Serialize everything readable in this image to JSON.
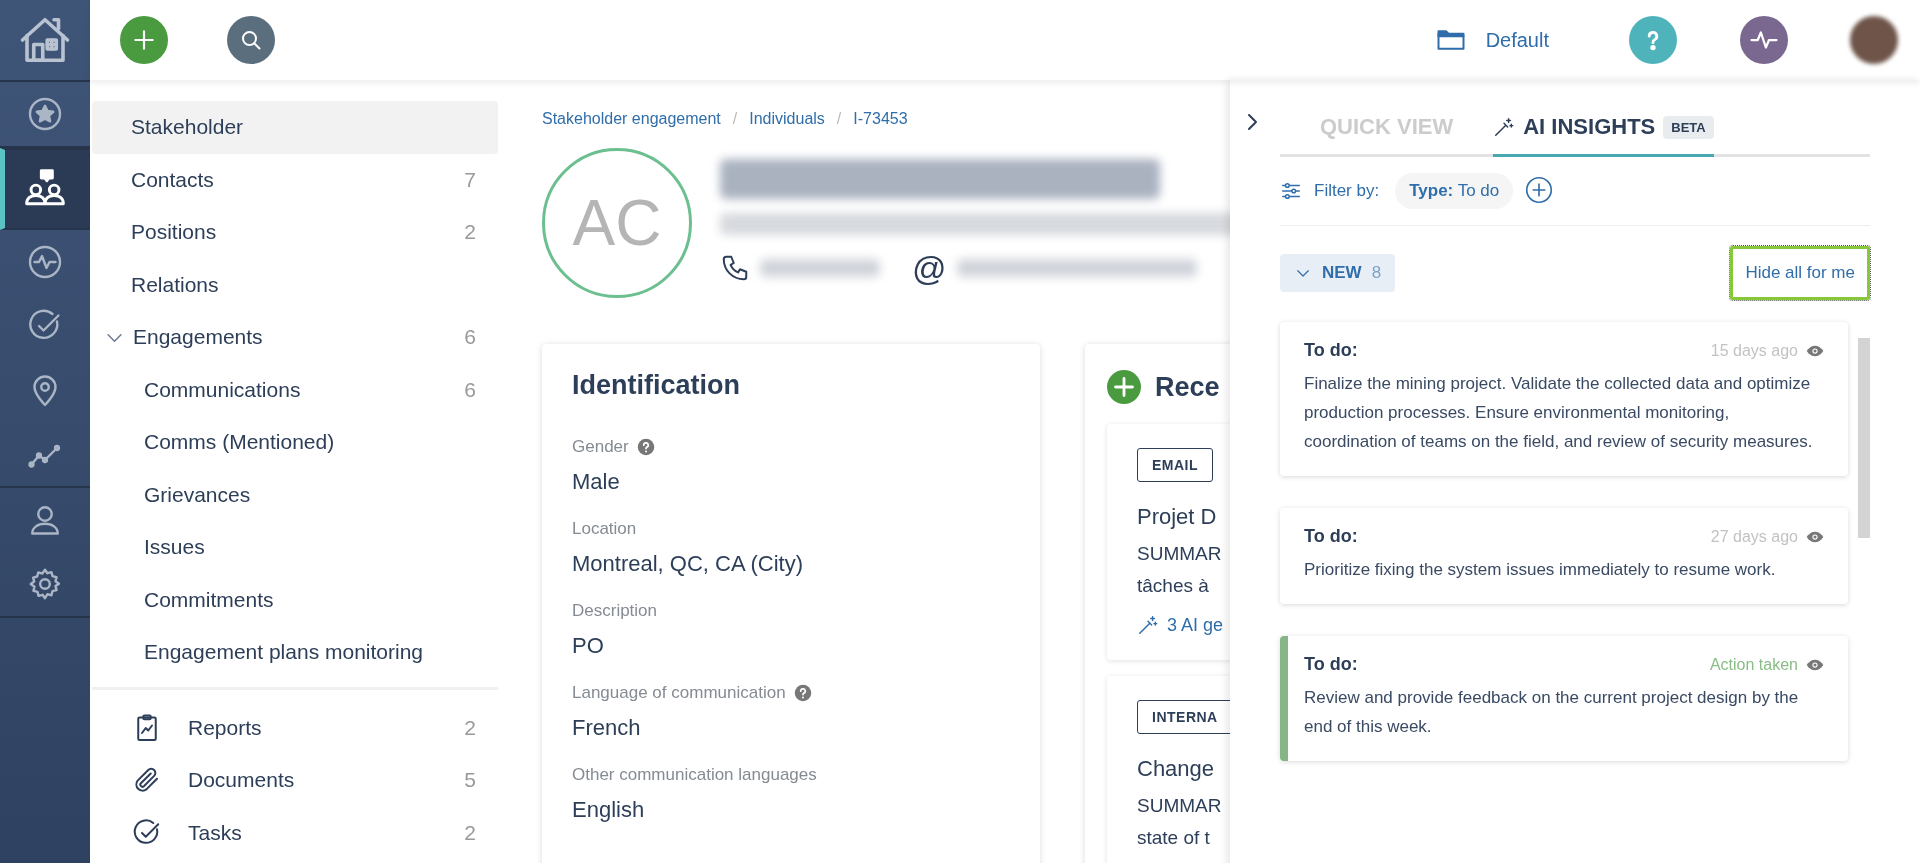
{
  "nav_rail": {
    "items": [
      {
        "selected": false
      },
      {
        "selected": true
      },
      {
        "selected": false
      },
      {
        "selected": false
      },
      {
        "selected": false
      },
      {
        "selected": false
      },
      {
        "selected": false
      },
      {
        "selected": false
      }
    ]
  },
  "top_bar": {
    "workspace": "Default"
  },
  "sidebar": {
    "items": [
      {
        "label": "Stakeholder",
        "selected": true
      },
      {
        "label": "Contacts",
        "count": "7",
        "selected": false
      },
      {
        "label": "Positions",
        "count": "2",
        "selected": false
      },
      {
        "label": "Relations",
        "selected": false
      },
      {
        "label": "Engagements",
        "count": "6",
        "selected": false,
        "expanded": true,
        "children": [
          {
            "label": "Communications",
            "count": "6",
            "selected": false
          },
          {
            "label": "Comms (Mentioned)",
            "selected": false
          },
          {
            "label": "Grievances",
            "selected": false
          },
          {
            "label": "Issues",
            "selected": false
          },
          {
            "label": "Commitments",
            "selected": false
          },
          {
            "label": "Engagement plans monitoring",
            "selected": false
          }
        ]
      }
    ],
    "modules": [
      {
        "label": "Reports",
        "count": "2",
        "selected": false
      },
      {
        "label": "Documents",
        "count": "5",
        "selected": false
      },
      {
        "label": "Tasks",
        "count": "2",
        "selected": false
      }
    ]
  },
  "breadcrumb": {
    "separator": "/",
    "items": [
      "Stakeholder engagement",
      "Individuals",
      "I-73453"
    ]
  },
  "profile": {
    "initials": "AC",
    "email_icon": "@"
  },
  "identification": {
    "title": "Identification",
    "fields": [
      {
        "label": "Gender",
        "value": "Male",
        "help": true
      },
      {
        "label": "Location",
        "value": "Montreal, QC, CA (City)",
        "help": false
      },
      {
        "label": "Description",
        "value": "PO",
        "help": false
      },
      {
        "label": "Language of communication",
        "value": "French",
        "help": true
      },
      {
        "label": "Other communication languages",
        "value": "English",
        "help": false
      }
    ]
  },
  "recent": {
    "title": "Rece",
    "items": [
      {
        "tag": "EMAIL",
        "title": "Projet D",
        "summary": [
          "SUMMAR",
          "tâches à"
        ],
        "ai_link": "3 AI ge"
      },
      {
        "tag": "INTERNA",
        "title": "Change",
        "summary": [
          "SUMMAR",
          "state of t"
        ]
      }
    ]
  },
  "panel": {
    "tabs": [
      {
        "label": "QUICK VIEW",
        "selected": false
      },
      {
        "label": "AI INSIGHTS",
        "badge": "BETA",
        "selected": true
      }
    ],
    "filter": {
      "label": "Filter by:",
      "chips": [
        {
          "key": "Type:",
          "value": "To do"
        }
      ]
    },
    "group": {
      "label": "NEW",
      "count": "8",
      "expanded": true
    },
    "hide_button": "Hide all for me",
    "insights": [
      {
        "title": "To do:",
        "status": "15 days ago",
        "action_taken": false,
        "text": "Finalize the mining project. Validate the collected data and optimize production processes. Ensure environmental monitoring, coordination of teams on the field, and review of security measures."
      },
      {
        "title": "To do:",
        "status": "27 days ago",
        "action_taken": false,
        "text": "Prioritize fixing the system issues immediately to resume work."
      },
      {
        "title": "To do:",
        "status": "Action taken",
        "action_taken": true,
        "text": "Review and provide feedback on the current project design by the end of this week."
      }
    ]
  }
}
